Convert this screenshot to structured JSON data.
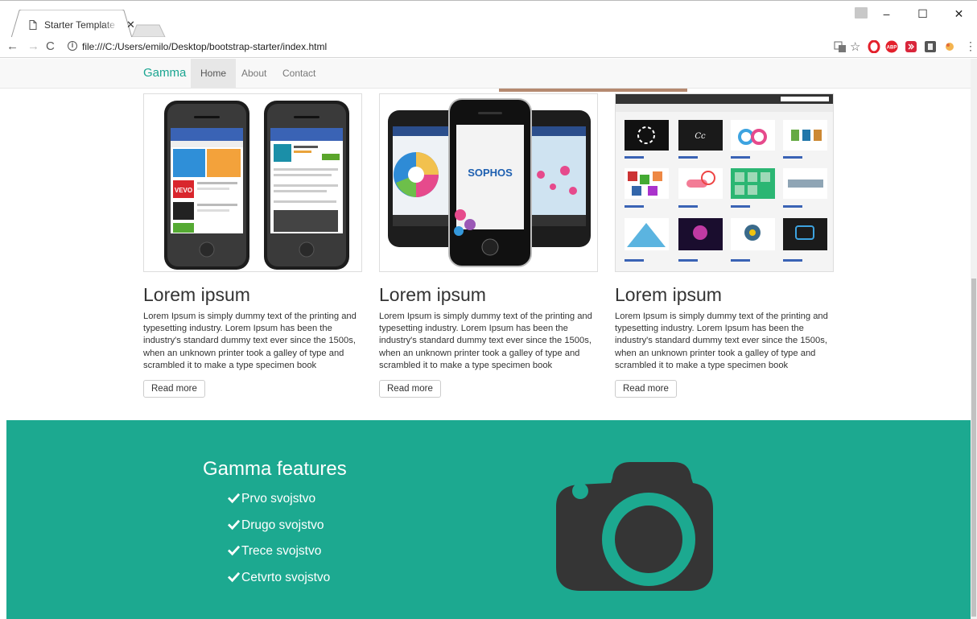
{
  "browser": {
    "tab_title": "Starter Template for Bootstrap",
    "url": "file:///C:/Users/emilo/Desktop/bootstrap-starter/index.html",
    "icons": [
      "page-icon",
      "close-icon",
      "back-icon",
      "forward-icon",
      "reload-icon",
      "info-icon",
      "translate-icon",
      "star-icon",
      "opera-icon",
      "adblock-icon",
      "ext-icon",
      "ext2-icon",
      "ext3-icon",
      "menu-icon"
    ]
  },
  "navbar": {
    "brand": "Gamma",
    "links": [
      "Home",
      "About",
      "Contact"
    ],
    "active": "Home"
  },
  "cards": [
    {
      "heading": "Lorem ipsum",
      "text": "Lorem Ipsum is simply dummy text of the printing and typesetting industry. Lorem Ipsum has been the industry's standard dummy text ever since the 1500s, when an unknown printer took a galley of type and scrambled it to make a type specimen book",
      "button": "Read more",
      "image": "two-phones-app-store"
    },
    {
      "heading": "Lorem ipsum",
      "text": "Lorem Ipsum is simply dummy text of the printing and typesetting industry. Lorem Ipsum has been the industry's standard dummy text ever since the 1500s, when an unknown printer took a galley of type and scrambled it to make a type specimen book",
      "button": "Read more",
      "image": "three-phones-sophos",
      "image_text": "SOPHOS"
    },
    {
      "heading": "Lorem ipsum",
      "text": "Lorem Ipsum is simply dummy text of the printing and typesetting industry. Lorem Ipsum has been the industry's standard dummy text ever since the 1500s, when an unknown printer took a galley of type and scrambled it to make a type specimen book",
      "button": "Read more",
      "image": "dribbble-gallery-grid"
    }
  ],
  "features": {
    "heading": "Gamma features",
    "items": [
      "Prvo svojstvo",
      "Drugo svojstvo",
      "Trece svojstvo",
      "Cetvrto svojstvo"
    ],
    "icon": "camera-icon"
  },
  "colors": {
    "accent": "#1ca990",
    "brand": "#1aa591",
    "camera": "#353535"
  }
}
